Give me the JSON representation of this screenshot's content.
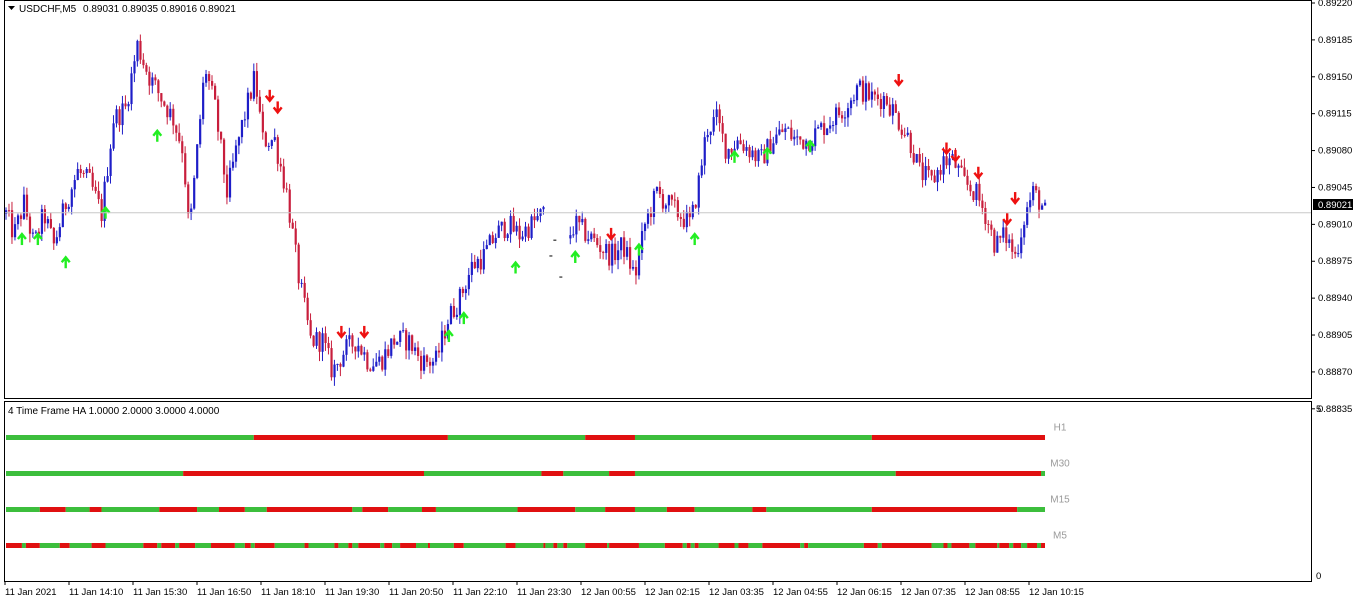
{
  "window": {
    "symbol_label": "USDCHF,M5",
    "ohlc_text": "0.89031 0.89035 0.89016 0.89021",
    "current_price": "0.89021"
  },
  "colors": {
    "bull_candle": "#1e1ec8",
    "bear_candle": "#c81e3c",
    "up_arrow": "#22ee22",
    "down_arrow": "#ee1111",
    "ha_green": "#3cbe3c",
    "ha_red": "#e01010"
  },
  "chart_data": [
    {
      "type": "candlestick",
      "title": "USDCHF,M5",
      "ylim": [
        0.8885,
        0.8922
      ],
      "y_ticks": [
        "0.89220",
        "0.89185",
        "0.89150",
        "0.89115",
        "0.89080",
        "0.89045",
        "0.89010",
        "0.88975",
        "0.88940",
        "0.88905",
        "0.88870",
        "0.88835"
      ],
      "x_ticks": [
        "11 Jan 2021",
        "11 Jan 14:10",
        "11 Jan 15:30",
        "11 Jan 16:50",
        "11 Jan 18:10",
        "11 Jan 19:30",
        "11 Jan 20:50",
        "11 Jan 22:10",
        "11 Jan 23:30",
        "12 Jan 00:55",
        "12 Jan 02:15",
        "12 Jan 03:35",
        "12 Jan 04:55",
        "12 Jan 06:15",
        "12 Jan 07:35",
        "12 Jan 08:55",
        "12 Jan 10:15"
      ],
      "last_price": 0.89021,
      "close_path": [
        [
          0,
          0.8902
        ],
        [
          8,
          0.89
        ],
        [
          18,
          0.8903
        ],
        [
          28,
          0.8899
        ],
        [
          38,
          0.8902
        ],
        [
          48,
          0.8899
        ],
        [
          60,
          0.8903
        ],
        [
          72,
          0.8906
        ],
        [
          84,
          0.8905
        ],
        [
          96,
          0.8902
        ],
        [
          108,
          0.8911
        ],
        [
          120,
          0.8912
        ],
        [
          132,
          0.8918
        ],
        [
          144,
          0.8915
        ],
        [
          156,
          0.8913
        ],
        [
          168,
          0.8911
        ],
        [
          178,
          0.8908
        ],
        [
          184,
          0.89
        ],
        [
          192,
          0.8908
        ],
        [
          200,
          0.8916
        ],
        [
          210,
          0.8912
        ],
        [
          222,
          0.8904
        ],
        [
          236,
          0.891
        ],
        [
          250,
          0.8915
        ],
        [
          258,
          0.8909
        ],
        [
          270,
          0.8909
        ],
        [
          282,
          0.8904
        ],
        [
          294,
          0.8896
        ],
        [
          306,
          0.889
        ],
        [
          318,
          0.889
        ],
        [
          328,
          0.8887
        ],
        [
          340,
          0.8889
        ],
        [
          352,
          0.889
        ],
        [
          364,
          0.8888
        ],
        [
          376,
          0.8888
        ],
        [
          390,
          0.889
        ],
        [
          404,
          0.889
        ],
        [
          418,
          0.8888
        ],
        [
          432,
          0.8888
        ],
        [
          444,
          0.8892
        ],
        [
          456,
          0.8894
        ],
        [
          468,
          0.8897
        ],
        [
          480,
          0.8898
        ],
        [
          492,
          0.89
        ],
        [
          504,
          0.8901
        ],
        [
          516,
          0.89
        ],
        [
          528,
          0.8901
        ],
        [
          540,
          0.8902
        ],
        [
          548,
          0.8899
        ],
        [
          560,
          0.8899
        ],
        [
          572,
          0.8901
        ],
        [
          584,
          0.89
        ],
        [
          596,
          0.8899
        ],
        [
          608,
          0.8898
        ],
        [
          620,
          0.8899
        ],
        [
          632,
          0.8896
        ],
        [
          642,
          0.8901
        ],
        [
          654,
          0.8904
        ],
        [
          664,
          0.8903
        ],
        [
          676,
          0.8902
        ],
        [
          688,
          0.8901
        ],
        [
          696,
          0.8905
        ],
        [
          704,
          0.891
        ],
        [
          714,
          0.8911
        ],
        [
          724,
          0.8908
        ],
        [
          736,
          0.8909
        ],
        [
          748,
          0.8908
        ],
        [
          758,
          0.8907
        ],
        [
          770,
          0.8909
        ],
        [
          782,
          0.891
        ],
        [
          794,
          0.8909
        ],
        [
          806,
          0.8909
        ],
        [
          818,
          0.891
        ],
        [
          830,
          0.8911
        ],
        [
          842,
          0.8912
        ],
        [
          856,
          0.8914
        ],
        [
          870,
          0.8913
        ],
        [
          884,
          0.8913
        ],
        [
          896,
          0.8911
        ],
        [
          908,
          0.8909
        ],
        [
          918,
          0.8906
        ],
        [
          930,
          0.8905
        ],
        [
          942,
          0.8907
        ],
        [
          952,
          0.8907
        ],
        [
          962,
          0.8905
        ],
        [
          974,
          0.8904
        ],
        [
          984,
          0.8902
        ],
        [
          994,
          0.8899
        ],
        [
          1004,
          0.89
        ],
        [
          1014,
          0.8898
        ],
        [
          1024,
          0.8902
        ],
        [
          1032,
          0.8904
        ],
        [
          1040,
          0.8903
        ],
        [
          1044,
          0.89021
        ]
      ],
      "no_bar_gaps": [
        [
          541,
          564
        ]
      ],
      "signals": [
        {
          "type": "up",
          "bar": 16,
          "price": 0.88997
        },
        {
          "type": "up",
          "bar": 32,
          "price": 0.88997
        },
        {
          "type": "up",
          "bar": 60,
          "price": 0.88975
        },
        {
          "type": "up",
          "bar": 100,
          "price": 0.89022
        },
        {
          "type": "up",
          "bar": 152,
          "price": 0.89095
        },
        {
          "type": "down",
          "bar": 265,
          "price": 0.89131
        },
        {
          "type": "down",
          "bar": 273,
          "price": 0.8912
        },
        {
          "type": "down",
          "bar": 337,
          "price": 0.88907
        },
        {
          "type": "down",
          "bar": 360,
          "price": 0.88907
        },
        {
          "type": "up",
          "bar": 445,
          "price": 0.88905
        },
        {
          "type": "up",
          "bar": 460,
          "price": 0.88922
        },
        {
          "type": "up",
          "bar": 512,
          "price": 0.8897
        },
        {
          "type": "up",
          "bar": 572,
          "price": 0.8898
        },
        {
          "type": "down",
          "bar": 608,
          "price": 0.89
        },
        {
          "type": "up",
          "bar": 636,
          "price": 0.88987
        },
        {
          "type": "up",
          "bar": 692,
          "price": 0.88997
        },
        {
          "type": "up",
          "bar": 732,
          "price": 0.89075
        },
        {
          "type": "up",
          "bar": 765,
          "price": 0.89078
        },
        {
          "type": "up",
          "bar": 808,
          "price": 0.89085
        },
        {
          "type": "down",
          "bar": 897,
          "price": 0.89146
        },
        {
          "type": "down",
          "bar": 945,
          "price": 0.89081
        },
        {
          "type": "down",
          "bar": 954,
          "price": 0.89074
        },
        {
          "type": "down",
          "bar": 977,
          "price": 0.89058
        },
        {
          "type": "down",
          "bar": 1006,
          "price": 0.89014
        },
        {
          "type": "down",
          "bar": 1014,
          "price": 0.89034
        }
      ]
    },
    {
      "type": "heatmap",
      "title": "4 Time Frame HA 1.0000 2.0000 3.0000 4.0000",
      "ylim": [
        0,
        5
      ],
      "y_ticks": [
        "5",
        "0"
      ],
      "rows": [
        {
          "name": "H1",
          "level": 4,
          "segments": [
            [
              "g",
              0,
              249
            ],
            [
              "r",
              249,
              444
            ],
            [
              "g",
              444,
              582
            ],
            [
              "r",
              582,
              632
            ],
            [
              "g",
              632,
              870
            ],
            [
              "r",
              870,
              1044
            ]
          ]
        },
        {
          "name": "M30",
          "level": 3,
          "segments": [
            [
              "g",
              0,
              178
            ],
            [
              "r",
              178,
              420
            ],
            [
              "g",
              420,
              538
            ],
            [
              "r",
              538,
              560
            ],
            [
              "g",
              560,
              606
            ],
            [
              "r",
              606,
              632
            ],
            [
              "g",
              632,
              894
            ],
            [
              "r",
              894,
              1040
            ],
            [
              "g",
              1040,
              1044
            ]
          ]
        },
        {
          "name": "M15",
          "level": 2,
          "segments": [
            [
              "g",
              0,
              34
            ],
            [
              "r",
              34,
              60
            ],
            [
              "g",
              60,
              84
            ],
            [
              "r",
              84,
              96
            ],
            [
              "g",
              96,
              154
            ],
            [
              "r",
              154,
              192
            ],
            [
              "g",
              192,
              214
            ],
            [
              "r",
              214,
              240
            ],
            [
              "g",
              240,
              262
            ],
            [
              "r",
              262,
              348
            ],
            [
              "g",
              348,
              358
            ],
            [
              "r",
              358,
              384
            ],
            [
              "g",
              384,
              418
            ],
            [
              "r",
              418,
              432
            ],
            [
              "g",
              432,
              514
            ],
            [
              "r",
              514,
              572
            ],
            [
              "g",
              572,
              602
            ],
            [
              "r",
              602,
              632
            ],
            [
              "g",
              632,
              664
            ],
            [
              "r",
              664,
              692
            ],
            [
              "g",
              692,
              750
            ],
            [
              "r",
              750,
              764
            ],
            [
              "g",
              764,
              870
            ],
            [
              "r",
              870,
              1016
            ],
            [
              "g",
              1016,
              1044
            ]
          ]
        },
        {
          "name": "M5",
          "level": 1,
          "segments": [
            [
              "r",
              0,
              16
            ],
            [
              "g",
              16,
              20
            ],
            [
              "r",
              20,
              34
            ],
            [
              "g",
              34,
              54
            ],
            [
              "r",
              54,
              64
            ],
            [
              "g",
              64,
              86
            ],
            [
              "r",
              86,
              100
            ],
            [
              "g",
              100,
              138
            ],
            [
              "r",
              138,
              152
            ],
            [
              "g",
              152,
              156
            ],
            [
              "r",
              156,
              170
            ],
            [
              "g",
              170,
              174
            ],
            [
              "r",
              174,
              190
            ],
            [
              "g",
              190,
              206
            ],
            [
              "r",
              206,
              230
            ],
            [
              "g",
              230,
              240
            ],
            [
              "r",
              240,
              246
            ],
            [
              "g",
              246,
              250
            ],
            [
              "r",
              250,
              270
            ],
            [
              "g",
              270,
              300
            ],
            [
              "r",
              300,
              304
            ],
            [
              "g",
              304,
              330
            ],
            [
              "r",
              330,
              334
            ],
            [
              "g",
              334,
              344
            ],
            [
              "r",
              344,
              348
            ],
            [
              "g",
              348,
              354
            ],
            [
              "r",
              354,
              376
            ],
            [
              "g",
              376,
              380
            ],
            [
              "r",
              380,
              388
            ],
            [
              "g",
              388,
              396
            ],
            [
              "r",
              396,
              412
            ],
            [
              "g",
              412,
              424
            ],
            [
              "r",
              424,
              426
            ],
            [
              "g",
              426,
              450
            ],
            [
              "r",
              450,
              460
            ],
            [
              "g",
              460,
              502
            ],
            [
              "r",
              502,
              512
            ],
            [
              "g",
              512,
              540
            ],
            [
              "r",
              540,
              542
            ],
            [
              "g",
              542,
              550
            ],
            [
              "r",
              550,
              554
            ],
            [
              "g",
              554,
              560
            ],
            [
              "r",
              560,
              564
            ],
            [
              "g",
              564,
              582
            ],
            [
              "r",
              582,
              604
            ],
            [
              "g",
              604,
              606
            ],
            [
              "r",
              606,
              636
            ],
            [
              "g",
              636,
              662
            ],
            [
              "r",
              662,
              680
            ],
            [
              "g",
              680,
              684
            ],
            [
              "r",
              684,
              688
            ],
            [
              "g",
              688,
              692
            ],
            [
              "r",
              692,
              696
            ],
            [
              "g",
              696,
              716
            ],
            [
              "r",
              716,
              732
            ],
            [
              "g",
              732,
              736
            ],
            [
              "r",
              736,
              746
            ],
            [
              "g",
              746,
              760
            ],
            [
              "r",
              760,
              798
            ],
            [
              "g",
              798,
              802
            ],
            [
              "r",
              802,
              806
            ],
            [
              "g",
              806,
              862
            ],
            [
              "r",
              862,
              876
            ],
            [
              "g",
              876,
              880
            ],
            [
              "r",
              880,
              930
            ],
            [
              "g",
              930,
              942
            ],
            [
              "r",
              942,
              946
            ],
            [
              "g",
              946,
              950
            ],
            [
              "r",
              950,
              968
            ],
            [
              "g",
              968,
              974
            ],
            [
              "r",
              974,
              996
            ],
            [
              "g",
              996,
              998
            ],
            [
              "r",
              998,
              1008
            ],
            [
              "g",
              1008,
              1012
            ],
            [
              "r",
              1012,
              1020
            ],
            [
              "g",
              1020,
              1026
            ],
            [
              "r",
              1026,
              1036
            ],
            [
              "g",
              1036,
              1040
            ],
            [
              "r",
              1040,
              1044
            ]
          ]
        }
      ]
    }
  ]
}
